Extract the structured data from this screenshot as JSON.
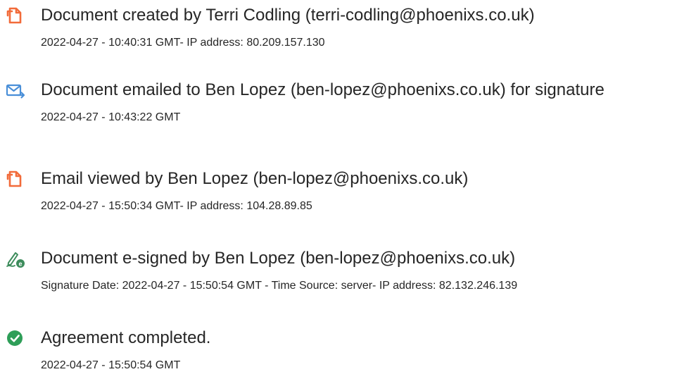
{
  "audit_trail": {
    "events": [
      {
        "icon": "document-created-icon",
        "title": "Document created by Terri Codling (terri-codling@phoenixs.co.uk)",
        "detail": "2022-04-27 - 10:40:31 GMT- IP address: 80.209.157.130"
      },
      {
        "icon": "email-sent-icon",
        "title": "Document emailed to Ben Lopez (ben-lopez@phoenixs.co.uk) for signature",
        "detail": "2022-04-27 - 10:43:22 GMT"
      },
      {
        "icon": "document-viewed-icon",
        "title": "Email viewed by Ben Lopez (ben-lopez@phoenixs.co.uk)",
        "detail": "2022-04-27 - 15:50:34 GMT- IP address: 104.28.89.85"
      },
      {
        "icon": "e-sign-icon",
        "title": "Document e-signed by Ben Lopez (ben-lopez@phoenixs.co.uk)",
        "detail": "Signature Date: 2022-04-27 - 15:50:54 GMT - Time Source: server- IP address: 82.132.246.139"
      },
      {
        "icon": "check-circle-icon",
        "title": "Agreement completed.",
        "detail": "2022-04-27 - 15:50:54 GMT"
      }
    ]
  },
  "colors": {
    "text": "#262626",
    "document_icon": "#f26b3a",
    "email_icon": "#4a8fd8",
    "sign_icon": "#3d8c5c",
    "completed_icon": "#2e9e58"
  }
}
